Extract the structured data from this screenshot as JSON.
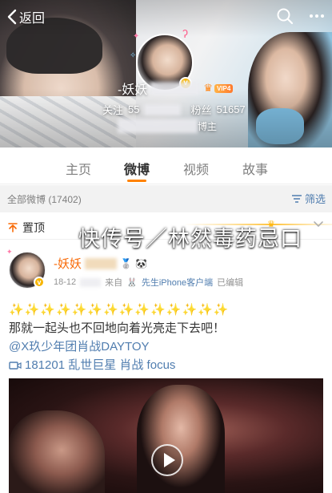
{
  "header": {
    "back_label": "返回",
    "nickname": "-妖妖",
    "vip_label": "VIP4",
    "following_label": "关注",
    "following_count": "55",
    "followers_label": "粉丝",
    "followers_count": "51657",
    "desc_suffix": "博主"
  },
  "tabs": [
    {
      "label": "主页",
      "active": false
    },
    {
      "label": "微博",
      "active": true
    },
    {
      "label": "视频",
      "active": false
    },
    {
      "label": "故事",
      "active": false
    }
  ],
  "filter": {
    "count_label": "全部微博 (17402)",
    "filter_label": "筛选"
  },
  "pinned": {
    "label": "置顶"
  },
  "post": {
    "author": "-妖妖",
    "date": "18-12",
    "source_prefix": "来自",
    "source": "先生iPhone客户端",
    "edited": "已编辑",
    "sparkles": "✨✨✨✨✨✨✨✨✨✨✨✨✨✨",
    "line1": "那就一起头也不回地向着光亮走下去吧！",
    "mention": "@X玖少年团肖战DAYTOY",
    "video_link": "181201 乱世巨星 肖战 focus"
  },
  "watermark": "快传号／林然毒药忌口",
  "colors": {
    "accent": "#ff8200",
    "link": "#507daf",
    "name": "#f86a07",
    "verified": "#f7b500"
  }
}
